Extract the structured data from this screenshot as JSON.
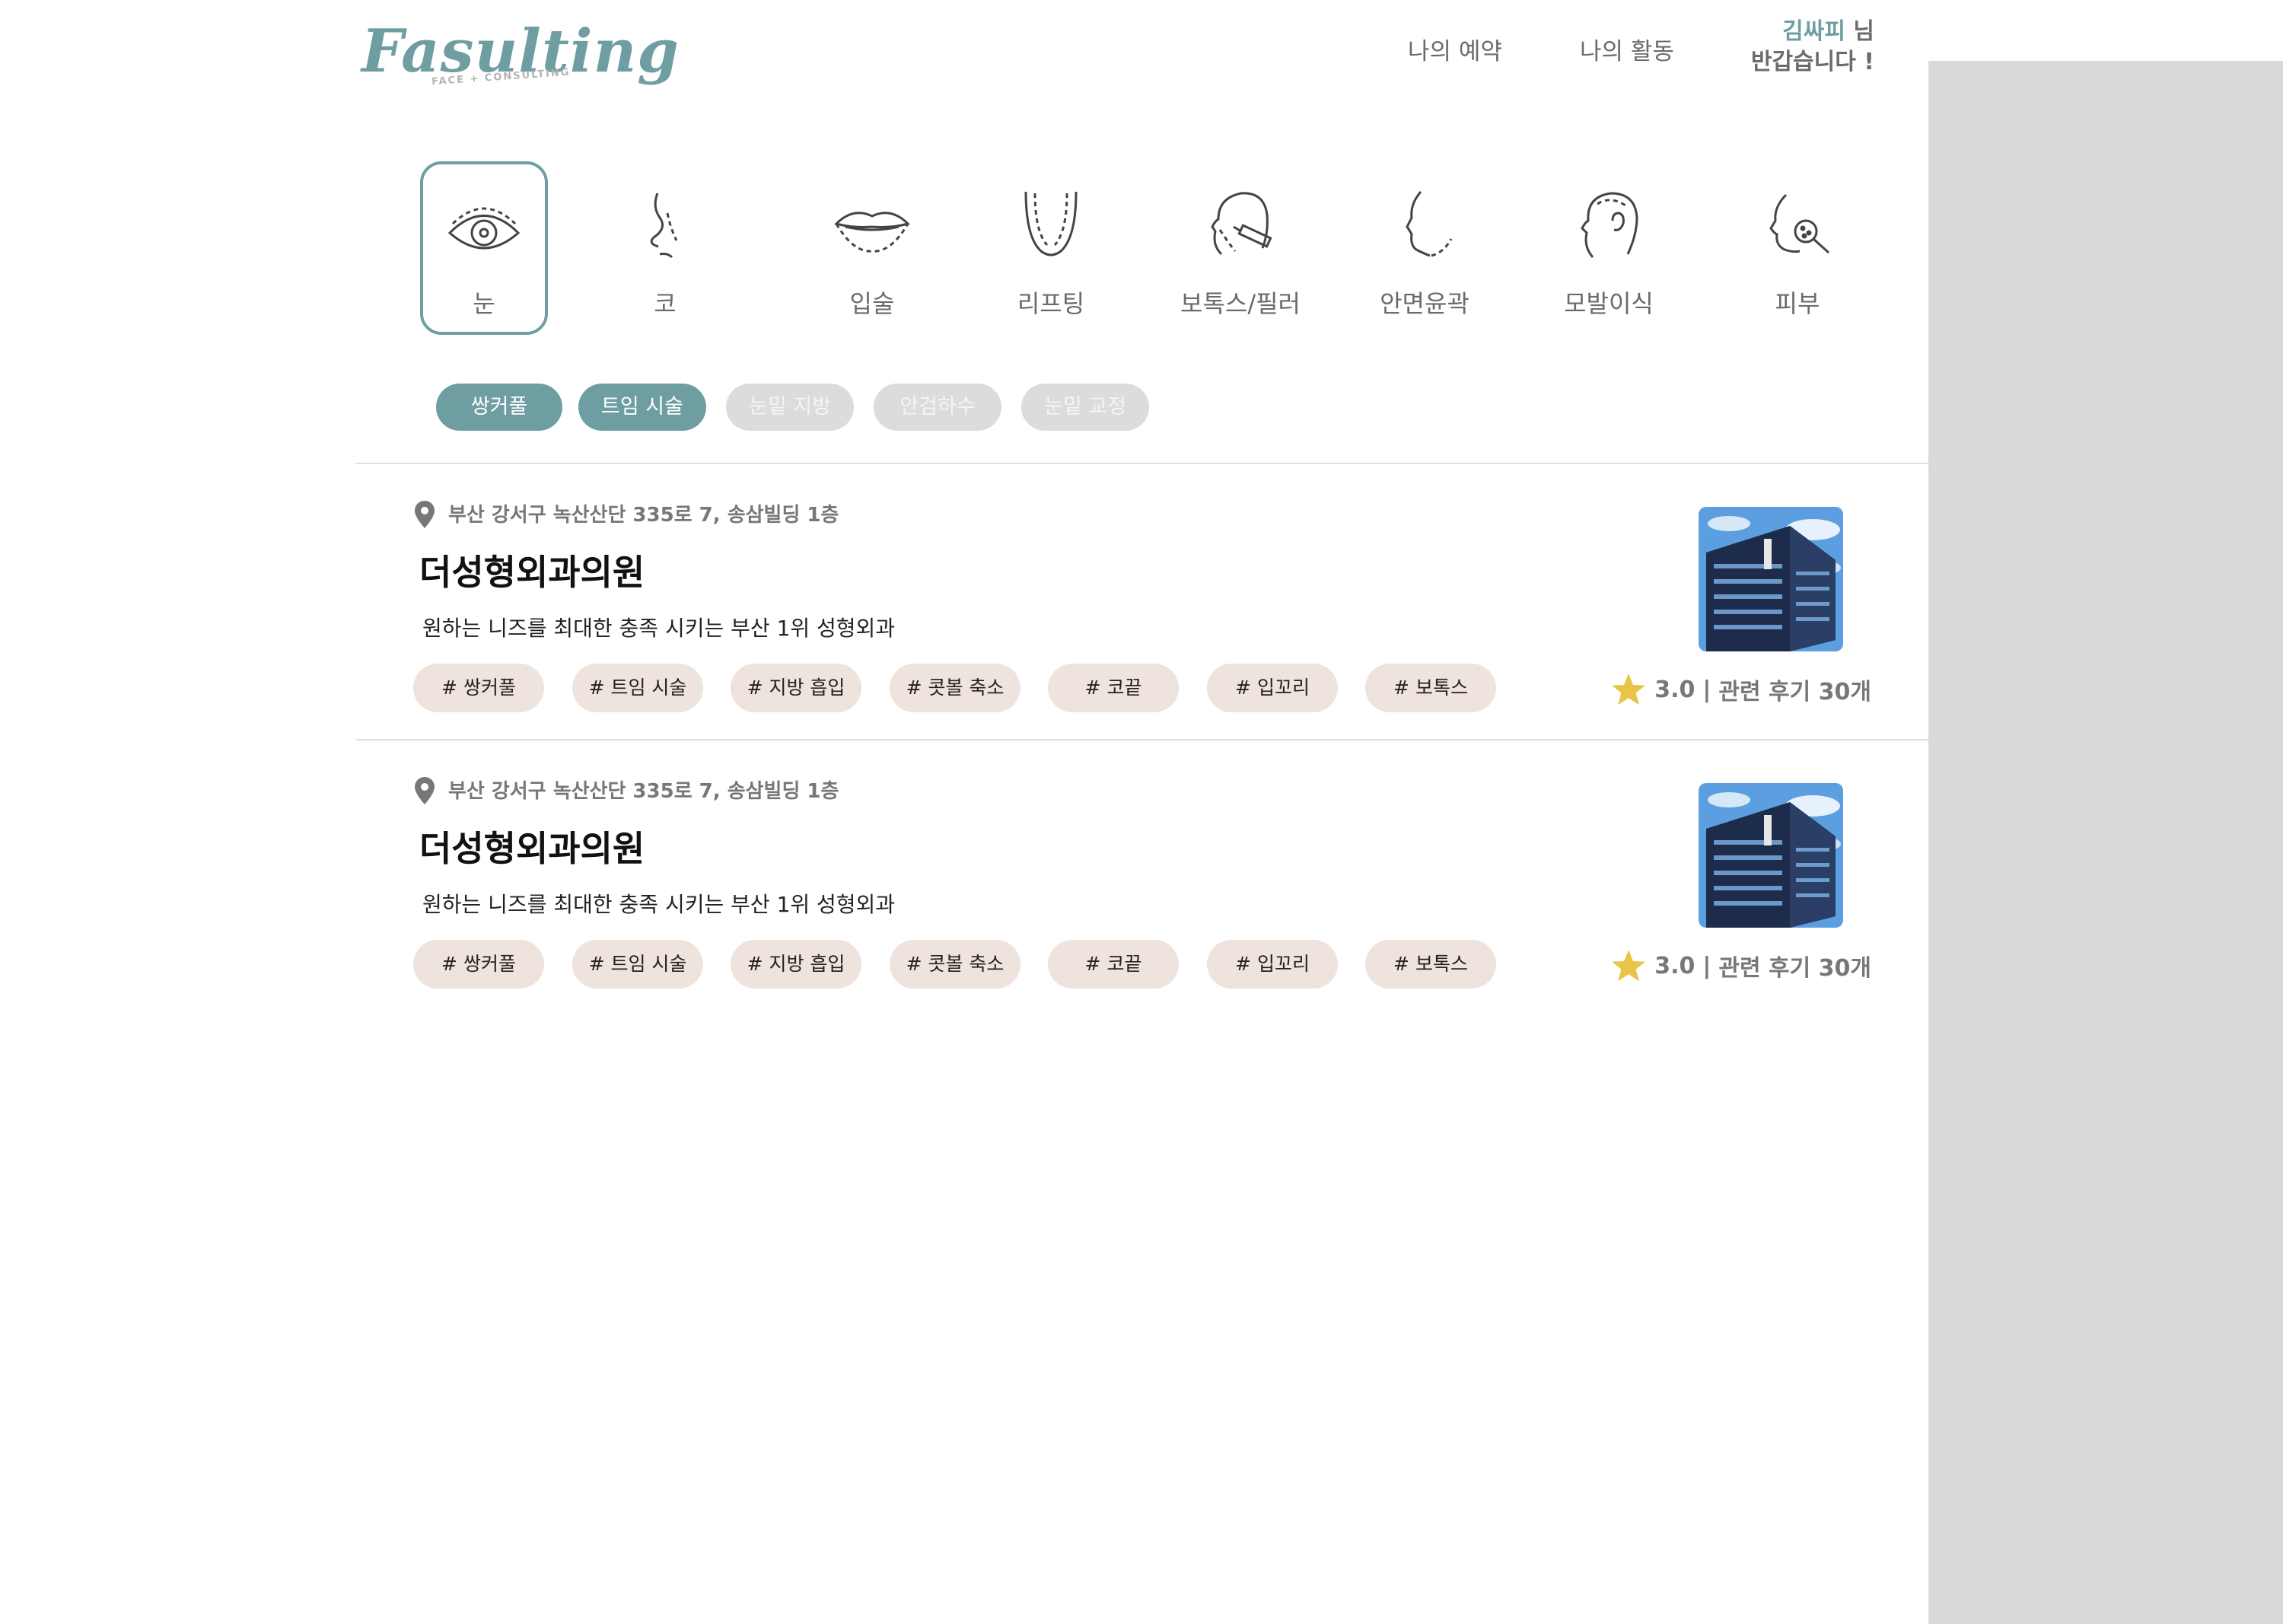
{
  "header": {
    "logo_text": "Fasulting",
    "logo_subtext": "FACE + CONSULTING",
    "nav": [
      "나의 예약",
      "나의 활동"
    ],
    "greeting_name": "김싸피",
    "greeting_suffix": " 님",
    "greeting_line2": "반갑습니다 !"
  },
  "categories": [
    {
      "label": "눈",
      "icon": "eye-icon",
      "active": true
    },
    {
      "label": "코",
      "icon": "nose-icon",
      "active": false
    },
    {
      "label": "입술",
      "icon": "lips-icon",
      "active": false
    },
    {
      "label": "리프팅",
      "icon": "lifting-icon",
      "active": false
    },
    {
      "label": "보톡스/필러",
      "icon": "botox-icon",
      "active": false
    },
    {
      "label": "안면윤곽",
      "icon": "face-contour-icon",
      "active": false
    },
    {
      "label": "모발이식",
      "icon": "hair-icon",
      "active": false
    },
    {
      "label": "피부",
      "icon": "skin-icon",
      "active": false
    }
  ],
  "subcategories": [
    {
      "label": "쌍커풀",
      "selected": true
    },
    {
      "label": "트임 시술",
      "selected": true
    },
    {
      "label": "눈밑 지방",
      "selected": false
    },
    {
      "label": "안검하수",
      "selected": false
    },
    {
      "label": "눈밑 교정",
      "selected": false
    }
  ],
  "clinics": [
    {
      "address": "부산 강서구 녹산산단 335로 7, 송삼빌딩 1층",
      "name": "더성형외과의원",
      "description": "원하는 니즈를 최대한 충족 시키는 부산 1위 성형외과",
      "tags": [
        "# 쌍커풀",
        "# 트임 시술",
        "# 지방 흡입",
        "# 콧볼 축소",
        "# 코끝",
        "# 입꼬리",
        "# 보톡스"
      ],
      "rating": "3.0",
      "separator": "|",
      "reviews": "관련 후기 30개"
    },
    {
      "address": "부산 강서구 녹산산단 335로 7, 송삼빌딩 1층",
      "name": "더성형외과의원",
      "description": "원하는 니즈를 최대한 충족 시키는 부산 1위 성형외과",
      "tags": [
        "# 쌍커풀",
        "# 트임 시술",
        "# 지방 흡입",
        "# 콧볼 축소",
        "# 코끝",
        "# 입꼬리",
        "# 보톡스"
      ],
      "rating": "3.0",
      "separator": "|",
      "reviews": "관련 후기 30개"
    }
  ],
  "colors": {
    "accent": "#6e9ea2",
    "tag_bg": "#efe3dd",
    "pill_off": "#dcdcdc",
    "star": "#e8c547",
    "side_panel": "#d9d9d9"
  }
}
